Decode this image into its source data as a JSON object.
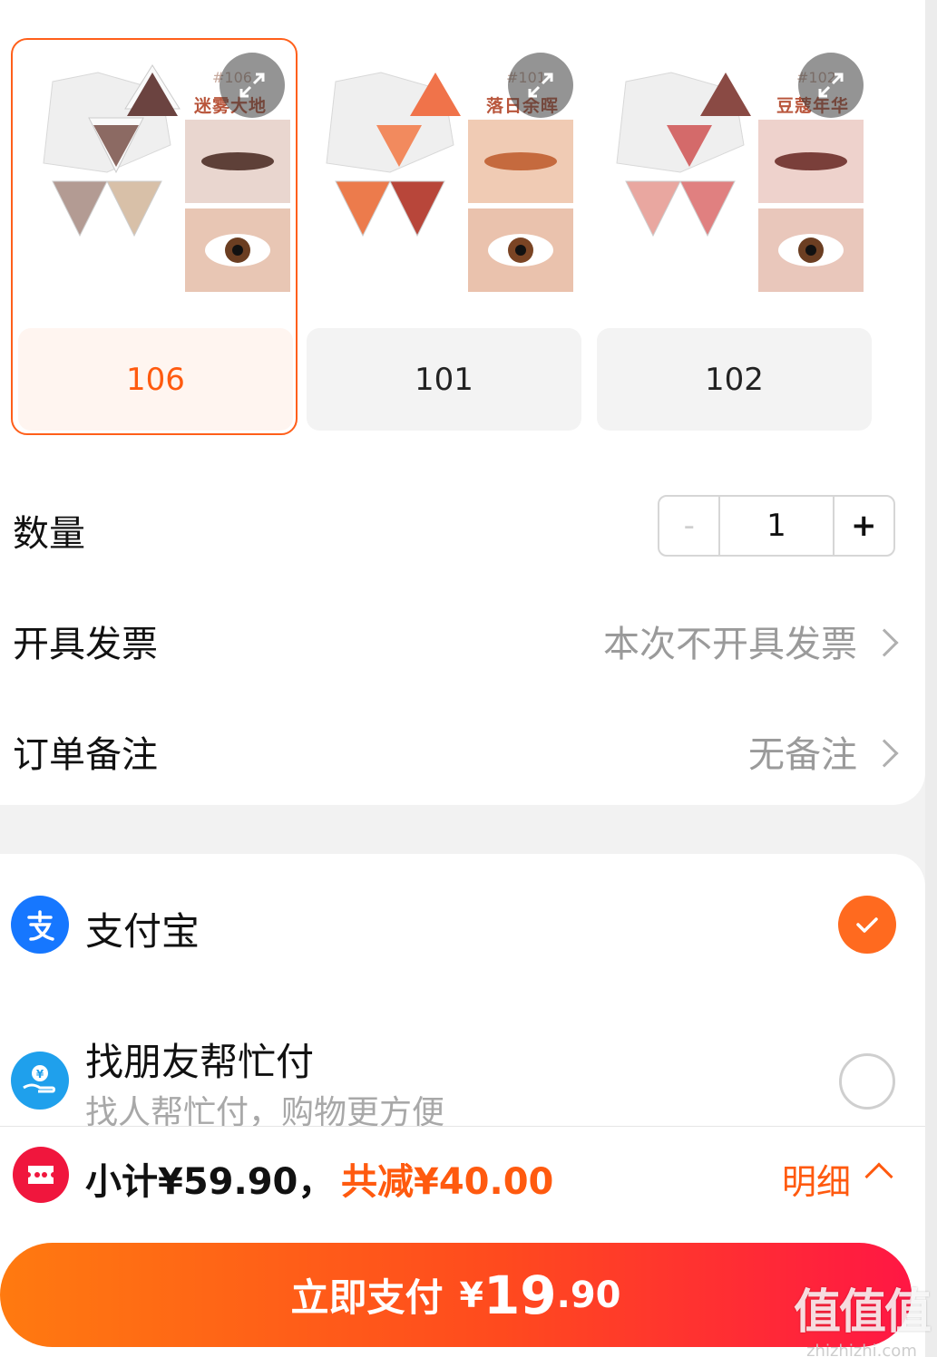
{
  "variants": [
    {
      "label": "106",
      "tag": "#106",
      "name": "迷雾大地",
      "selected": true,
      "colors": [
        "#6b4340",
        "#8c6a63",
        "#b39b93",
        "#d8c0a8"
      ]
    },
    {
      "label": "101",
      "tag": "#101",
      "name": "落日余晖",
      "selected": false,
      "colors": [
        "#f0734a",
        "#f28a5e",
        "#ec7b4c",
        "#b8463a"
      ]
    },
    {
      "label": "102",
      "tag": "#102",
      "name": "豆蔻年华",
      "selected": false,
      "colors": [
        "#8a4a44",
        "#d46a6a",
        "#e9a7a0",
        "#e08080"
      ]
    }
  ],
  "quantity": {
    "label": "数量",
    "minus": "-",
    "value": "1",
    "plus": "+"
  },
  "invoice": {
    "label": "开具发票",
    "value": "本次不开具发票"
  },
  "remark": {
    "label": "订单备注",
    "value": "无备注"
  },
  "payment": {
    "alipay": {
      "name": "支付宝",
      "icon": "alipay-icon",
      "selected": true
    },
    "friend": {
      "name": "找朋友帮忙付",
      "sub": "找人帮忙付，购物更方便",
      "icon": "friend-pay-icon",
      "selected": false
    }
  },
  "summary": {
    "subtotal": "小计¥59.90，",
    "discount": "共减¥40.00",
    "detail": "明细"
  },
  "pay_button": {
    "label": "立即支付",
    "currency": "¥",
    "integer": "19",
    "decimal": ".90"
  },
  "watermark": {
    "logo": "值值值",
    "site": "zhizhizhi.com"
  },
  "colors": {
    "accent": "#ff5a0f",
    "alipay": "#1677ff",
    "coupon": "#f0163d"
  }
}
